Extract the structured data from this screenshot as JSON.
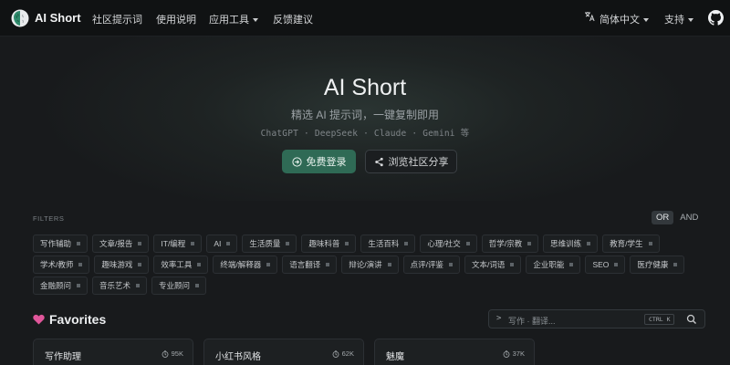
{
  "nav": {
    "brand": "AI Short",
    "links": [
      "社区提示词",
      "使用说明",
      "应用工具",
      "反馈建议"
    ],
    "language": "简体中文",
    "support": "支持"
  },
  "hero": {
    "title": "AI Short",
    "subtitle": "精选 AI 提示词，一键复制即用",
    "models": "ChatGPT · DeepSeek · Claude · Gemini 等",
    "login_button": "免费登录",
    "browse_button": "浏览社区分享"
  },
  "filters": {
    "label": "FILTERS",
    "or": "OR",
    "and": "AND",
    "tags": [
      "写作辅助",
      "文章/报告",
      "IT/编程",
      "AI",
      "生活质量",
      "趣味科普",
      "生活百科",
      "心理/社交",
      "哲学/宗教",
      "思维训练",
      "教育/学生",
      "学术/教师",
      "趣味游戏",
      "效率工具",
      "终端/解释器",
      "语言翻译",
      "辩论/演讲",
      "点评/评鉴",
      "文本/词语",
      "企业职能",
      "SEO",
      "医疗健康",
      "金融顾问",
      "音乐艺术",
      "专业顾问"
    ]
  },
  "favorites": {
    "title": "Favorites",
    "search_prompt": ">",
    "search_placeholder": "写作 · 翻译...",
    "shortcut": "CTRL K",
    "cards": [
      {
        "title": "写作助理",
        "count": "95K"
      },
      {
        "title": "小红书风格",
        "count": "62K"
      },
      {
        "title": "魅魔",
        "count": "37K"
      }
    ]
  },
  "icons": {
    "logo": "brain-logo-icon",
    "translate": "translate-icon",
    "github": "github-icon",
    "login": "login-icon",
    "share": "share-icon",
    "heart": "heart-icon",
    "search": "search-icon",
    "copy": "copy-count-icon"
  },
  "colors": {
    "background": "#181a1c",
    "nav": "#101213",
    "primary_button": "#2f6a55",
    "heart": "#e0569a"
  }
}
